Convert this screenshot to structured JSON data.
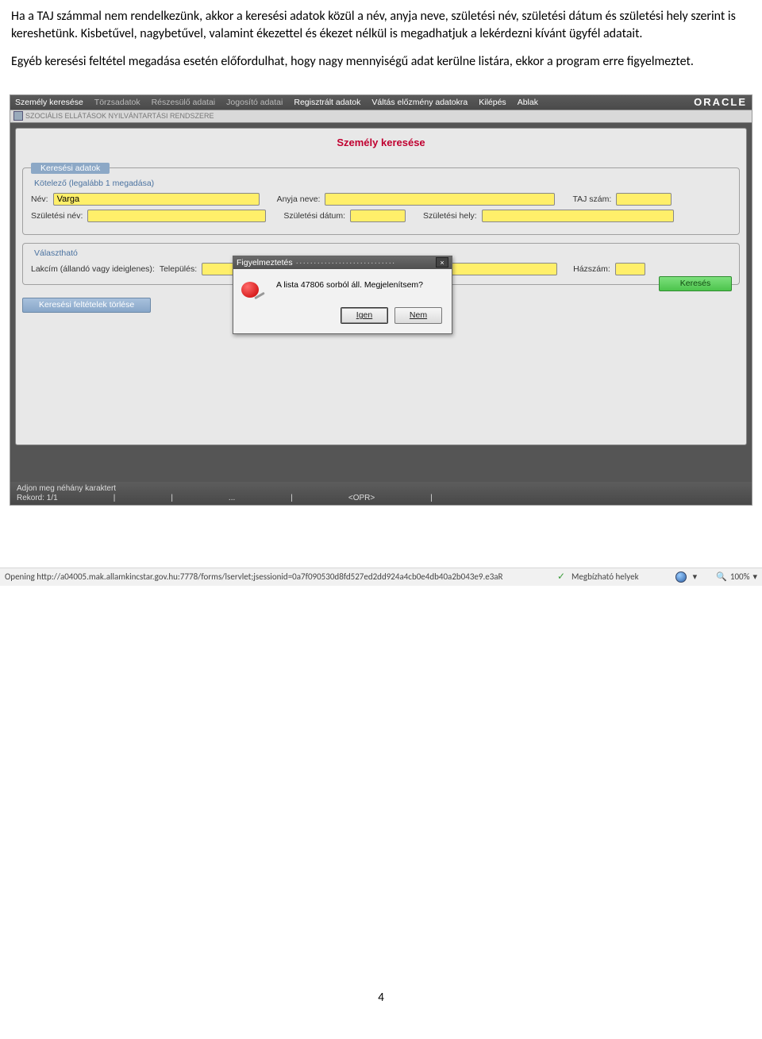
{
  "paragraphs": {
    "p1": "Ha a TAJ számmal nem rendelkezünk, akkor a keresési adatok közül a név, anyja neve, születési név, születési dátum és születési hely szerint is kereshetünk. Kisbetűvel, nagybetűvel, valamint ékezettel és ékezet nélkül is megadhatjuk a lekérdezni kívánt ügyfél adatait.",
    "p2": "Egyéb keresési feltétel megadása esetén előfordulhat, hogy nagy mennyiségű adat kerülne listára, ekkor a program erre figyelmeztet."
  },
  "menubar": {
    "items": [
      "Személy keresése",
      "Törzsadatok",
      "Részesülő adatai",
      "Jogosító adatai",
      "Regisztrált adatok",
      "Váltás előzmény adatokra",
      "Kilépés",
      "Ablak"
    ],
    "brand": "ORACLE"
  },
  "toolbar": {
    "title": "SZOCIÁLIS ELLÁTÁSOK NYILVÁNTARTÁSI RENDSZERE"
  },
  "form": {
    "title": "Személy keresése",
    "group1": {
      "legend": "Keresési adatok",
      "sub": "Kötelező (legalább 1 megadása)",
      "nev_label": "Név:",
      "nev_value": "Varga",
      "anyja_label": "Anyja neve:",
      "taj_label": "TAJ szám:",
      "szulnev_label": "Születési név:",
      "szuldatum_label": "Születési dátum:",
      "szulhely_label": "Születési hely:"
    },
    "group2": {
      "legend": "Választható",
      "lakcim_label": "Lakcím (állandó vagy ideiglenes):",
      "telepules_label": "Település:",
      "hazszam_label": "Házszám:"
    },
    "btn_clear": "Keresési feltételek törlése",
    "btn_search": "Keresés"
  },
  "dialog": {
    "title": "Figyelmeztetés",
    "message": "A lista 47806 sorból áll. Megjelenítsem?",
    "yes": "Igen",
    "no": "Nem",
    "close": "×"
  },
  "statusbar": {
    "line1": "Adjon meg néhány karaktert",
    "record": "Rekord: 1/1",
    "dots": "...",
    "mode": "<OPR>"
  },
  "ie_status": {
    "url": "Opening http://a04005.mak.allamkincstar.gov.hu:7778/forms/lservlet;jsessionid=0a7f090530d8fd527ed2dd924a4cb0e4db40a2b043e9.e3aR",
    "trusted": "Megbízható helyek",
    "zoom": "100%"
  },
  "page_number": "4"
}
